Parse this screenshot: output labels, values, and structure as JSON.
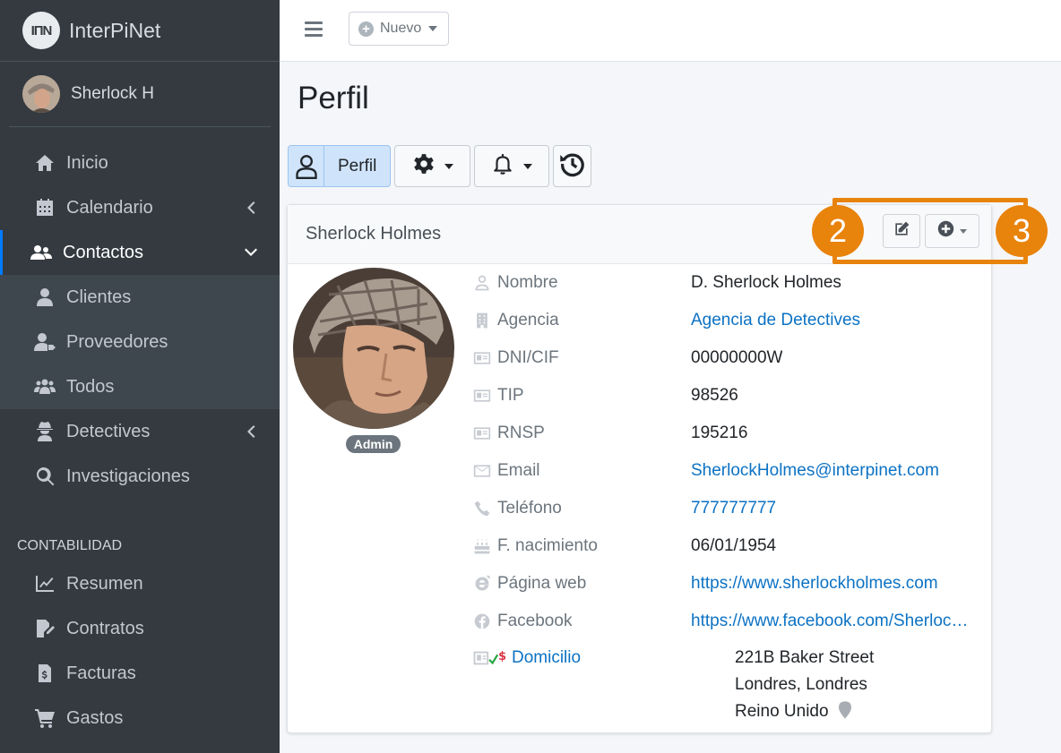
{
  "brand": {
    "logo_text": "IПN",
    "name_part1": "Inter",
    "name_part2": "Pi",
    "name_part3": "Net"
  },
  "user": {
    "name": "Sherlock H"
  },
  "sidebar": {
    "items": [
      {
        "label": "Inicio",
        "icon": "home-icon"
      },
      {
        "label": "Calendario",
        "icon": "calendar-icon"
      },
      {
        "label": "Contactos",
        "icon": "users-icon"
      },
      {
        "label": "Clientes",
        "icon": "user-tie-icon"
      },
      {
        "label": "Proveedores",
        "icon": "user-tag-icon"
      },
      {
        "label": "Todos",
        "icon": "users-group-icon"
      },
      {
        "label": "Detectives",
        "icon": "user-secret-icon"
      },
      {
        "label": "Investigaciones",
        "icon": "search-icon"
      }
    ],
    "section_header": "CONTABILIDAD",
    "accounting": [
      {
        "label": "Resumen",
        "icon": "chart-line-icon"
      },
      {
        "label": "Contratos",
        "icon": "file-signature-icon"
      },
      {
        "label": "Facturas",
        "icon": "invoice-icon"
      },
      {
        "label": "Gastos",
        "icon": "cart-icon"
      }
    ]
  },
  "topbar": {
    "nuevo_label": "Nuevo"
  },
  "page": {
    "title": "Perfil"
  },
  "tabs": {
    "perfil_label": "Perfil"
  },
  "card": {
    "title": "Sherlock Holmes",
    "badge": "Admin",
    "fields": [
      {
        "label": "Nombre",
        "value": "D. Sherlock Holmes"
      },
      {
        "label": "Agencia",
        "value": "Agencia de Detectives"
      },
      {
        "label": "DNI/CIF",
        "value": "00000000W"
      },
      {
        "label": "TIP",
        "value": "98526"
      },
      {
        "label": "RNSP",
        "value": "195216"
      },
      {
        "label": "Email",
        "value": "SherlockHolmes@interpinet.com"
      },
      {
        "label": "Teléfono",
        "value": "777777777"
      },
      {
        "label": "F. nacimiento",
        "value": "06/01/1954"
      },
      {
        "label": "Página web",
        "value": "https://www.sherlockholmes.com"
      },
      {
        "label": "Facebook",
        "value": "https://www.facebook.com/Sherloc…"
      }
    ],
    "domicilio": {
      "label": "Domicilio",
      "line1": "221B Baker Street",
      "line2": "Londres, Londres",
      "line3": "Reino Unido"
    }
  },
  "markers": {
    "left": "2",
    "right": "3"
  },
  "colors": {
    "sidebar_bg": "#343a40",
    "accent": "#007bff",
    "link": "#0c72c4",
    "highlight": "#e8830c"
  }
}
